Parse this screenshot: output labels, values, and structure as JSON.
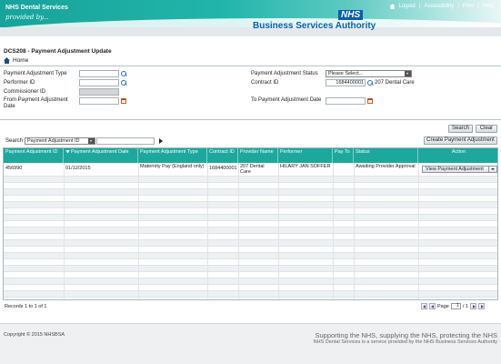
{
  "header": {
    "brand_title": "NHS Dental Services",
    "brand_sub": "provided by...",
    "nhs_logo": "NHS",
    "bsa_text": "Business Services Authority",
    "links": [
      "Logout",
      "Accessibility",
      "Print",
      "Help"
    ],
    "link_sep": "|"
  },
  "page": {
    "title": "DCS208 - Payment Adjustment Update",
    "home_label": "Home"
  },
  "filters": {
    "payment_adjustment_type_label": "Payment Adjustment Type",
    "performer_id_label": "Performer ID",
    "commissioner_id_label": "Commissioner ID",
    "from_date_label": "From Payment Adjustment Date",
    "status_label": "Payment Adjustment Status",
    "status_value": "Please Select...",
    "contract_id_label": "Contract ID",
    "contract_id_value": "1684400001",
    "contract_name": "207 Dental Care",
    "to_date_label": "To Payment Adjustment Date",
    "search_button": "Search",
    "clear_button": "Clear"
  },
  "grid_toolbar": {
    "search_label": "Search",
    "search_field_value": "Payment Adjustment ID",
    "create_button": "Create Payment Adjustment"
  },
  "table": {
    "columns": [
      "Payment Adjustment ID",
      "Payment Adjustment Date",
      "Payment Adjustment Type",
      "Contract ID",
      "Provider Name",
      "Performer",
      "Pay To",
      "Status",
      "Action"
    ],
    "rows": [
      {
        "id": "456990",
        "date": "01/12/2015",
        "type": "Maternity Pay (England only)",
        "contract": "1684400001",
        "provider": "207 Dental Care",
        "performer": "HILARY JAN SOFFER",
        "pay_to": "",
        "status": "Awaiting Provider Approval",
        "action": "View Payment Adjustment"
      }
    ]
  },
  "pagination": {
    "records_text": "Records 1 to 1 of 1",
    "page_label": "Page",
    "page_value": "1",
    "of_text": "/ 1"
  },
  "footer": {
    "copyright": "Copyright © 2015 NHSBSA",
    "tagline": "Supporting the NHS, supplying the NHS, protecting the NHS",
    "subtag": "NHS Dental Services is a service provided by the NHS Business Services Authority"
  },
  "colors": {
    "header_teal": "#1ea79d",
    "nhs_blue": "#0a5eab"
  }
}
